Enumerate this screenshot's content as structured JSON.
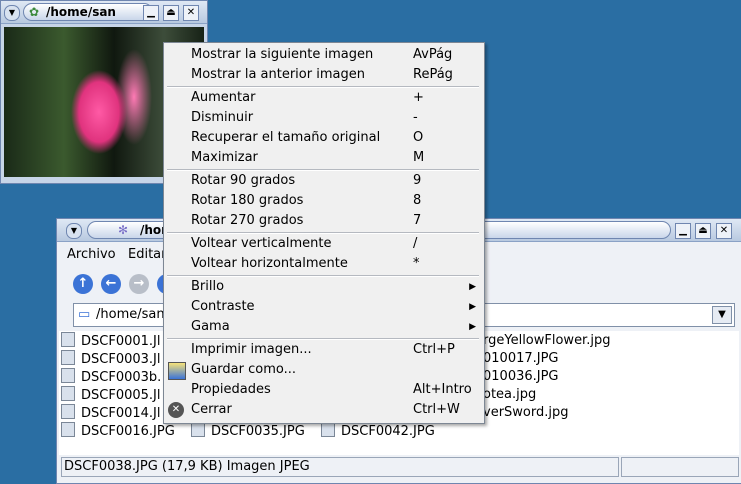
{
  "viewer": {
    "title": "/home/san",
    "image_alt": "pink flower photo"
  },
  "filemanager": {
    "title": "/hom",
    "menubar": [
      "Archivo",
      "Editar"
    ],
    "location": "/home/san",
    "files": [
      [
        "DSCF0001.Jl",
        "rgeYellowFlower.jpg"
      ],
      [
        "DSCF0003.Jl",
        "010017.JPG"
      ],
      [
        "DSCF0003b.",
        "010036.JPG"
      ],
      [
        "DSCF0005.Jl",
        "otea.jpg"
      ],
      [
        "DSCF0014.Jl",
        "verSword.jpg"
      ],
      [
        "DSCF0016.JPG",
        "DSCF0035.JPG",
        "DSCF0042.JPG"
      ]
    ],
    "status": "DSCF0038.JPG (17,9 KB)  Imagen JPEG"
  },
  "context_menu": {
    "groups": [
      [
        {
          "label": "Mostrar la siguiente imagen",
          "shortcut": "AvPág"
        },
        {
          "label": "Mostrar la anterior imagen",
          "shortcut": "RePág"
        }
      ],
      [
        {
          "label": "Aumentar",
          "shortcut": "+"
        },
        {
          "label": "Disminuir",
          "shortcut": "-"
        },
        {
          "label": "Recuperar el tamaño original",
          "shortcut": "O"
        },
        {
          "label": "Maximizar",
          "shortcut": "M"
        }
      ],
      [
        {
          "label": "Rotar 90 grados",
          "shortcut": "9"
        },
        {
          "label": "Rotar 180 grados",
          "shortcut": "8"
        },
        {
          "label": "Rotar 270 grados",
          "shortcut": "7"
        }
      ],
      [
        {
          "label": "Voltear verticalmente",
          "shortcut": "/"
        },
        {
          "label": "Voltear horizontalmente",
          "shortcut": "*"
        }
      ],
      [
        {
          "label": "Brillo",
          "submenu": true
        },
        {
          "label": "Contraste",
          "submenu": true
        },
        {
          "label": "Gama",
          "submenu": true
        }
      ],
      [
        {
          "label": "Imprimir imagen...",
          "shortcut": "Ctrl+P"
        },
        {
          "label": "Guardar como...",
          "icon": "save-icon"
        },
        {
          "label": "Propiedades",
          "shortcut": "Alt+Intro"
        },
        {
          "label": "Cerrar",
          "shortcut": "Ctrl+W",
          "icon": "close-icon"
        }
      ]
    ]
  },
  "colors": {
    "desktop": "#2a6ea3",
    "titlebar": "#c9d6ea",
    "menu_bg": "#f0f0f0",
    "nav_blue": "#3b73d6"
  }
}
